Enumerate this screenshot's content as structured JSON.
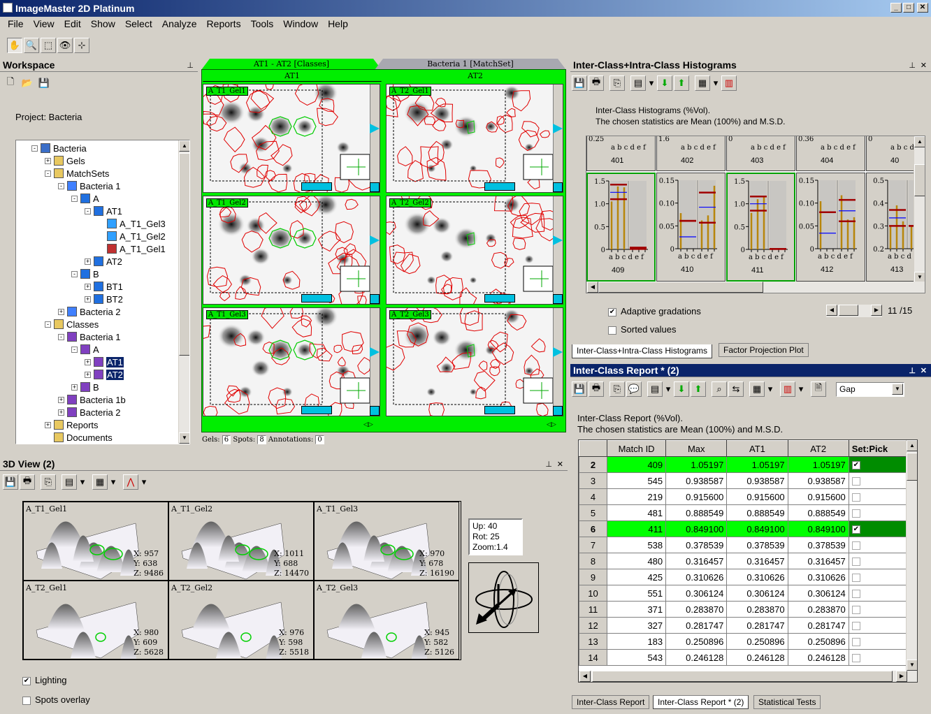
{
  "app": {
    "title": "ImageMaster 2D Platinum"
  },
  "menu": [
    "File",
    "View",
    "Edit",
    "Show",
    "Select",
    "Analyze",
    "Reports",
    "Tools",
    "Window",
    "Help"
  ],
  "toolbar": [
    {
      "icon": "hand-icon",
      "glyph": "✋"
    },
    {
      "icon": "zoom-icon",
      "glyph": "🔍"
    },
    {
      "icon": "rect-select-icon",
      "glyph": "⬚"
    },
    {
      "icon": "eye-icon",
      "glyph": "👁"
    },
    {
      "icon": "measure-icon",
      "glyph": "⊹"
    }
  ],
  "workspace": {
    "title": "Workspace",
    "project_label": "Project: Bacteria",
    "tree": [
      {
        "label": "Bacteria",
        "level": 0,
        "icon": "database",
        "exp": "-"
      },
      {
        "label": "Gels",
        "level": 1,
        "icon": "folder",
        "exp": "+"
      },
      {
        "label": "MatchSets",
        "level": 1,
        "icon": "folder",
        "exp": "-"
      },
      {
        "label": "Bacteria 1",
        "level": 2,
        "icon": "matchset",
        "exp": "-"
      },
      {
        "label": "A",
        "level": 3,
        "icon": "class",
        "exp": "-"
      },
      {
        "label": "AT1",
        "level": 4,
        "icon": "class",
        "exp": "-"
      },
      {
        "label": "A_T1_Gel3",
        "level": 5,
        "icon": "gel",
        "exp": ""
      },
      {
        "label": "A_T1_Gel2",
        "level": 5,
        "icon": "gel",
        "exp": ""
      },
      {
        "label": "A_T1_Gel1",
        "level": 5,
        "icon": "gelref",
        "exp": ""
      },
      {
        "label": "AT2",
        "level": 4,
        "icon": "class",
        "exp": "+"
      },
      {
        "label": "B",
        "level": 3,
        "icon": "class",
        "exp": "-"
      },
      {
        "label": "BT1",
        "level": 4,
        "icon": "class",
        "exp": "+"
      },
      {
        "label": "BT2",
        "level": 4,
        "icon": "class",
        "exp": "+"
      },
      {
        "label": "Bacteria 2",
        "level": 2,
        "icon": "matchset",
        "exp": "+"
      },
      {
        "label": "Classes",
        "level": 1,
        "icon": "folder",
        "exp": "-"
      },
      {
        "label": "Bacteria 1",
        "level": 2,
        "icon": "classes",
        "exp": "-"
      },
      {
        "label": "A",
        "level": 3,
        "icon": "classes",
        "exp": "-"
      },
      {
        "label": "AT1",
        "level": 4,
        "icon": "classes",
        "exp": "+",
        "selected": true
      },
      {
        "label": "AT2",
        "level": 4,
        "icon": "classes",
        "exp": "+",
        "selected": true
      },
      {
        "label": "B",
        "level": 3,
        "icon": "classes",
        "exp": "+"
      },
      {
        "label": "Bacteria 1b",
        "level": 2,
        "icon": "classes",
        "exp": "+"
      },
      {
        "label": "Bacteria 2",
        "level": 2,
        "icon": "classes",
        "exp": "+"
      },
      {
        "label": "Reports",
        "level": 1,
        "icon": "folder",
        "exp": "+"
      },
      {
        "label": "Documents",
        "level": 1,
        "icon": "folder",
        "exp": ""
      }
    ]
  },
  "gelview": {
    "tabs": [
      {
        "label": "AT1 - AT2 [Classes]",
        "active": true
      },
      {
        "label": "Bacteria 1 [MatchSet]",
        "active": false
      }
    ],
    "columns": [
      {
        "label": "AT1",
        "gels": [
          "A_T1_Gel1",
          "A_T1_Gel2",
          "A_T1_Gel3"
        ]
      },
      {
        "label": "AT2",
        "gels": [
          "A_T2_Gel1",
          "A_T2_Gel2",
          "A_T2_Gel3"
        ]
      }
    ],
    "status": {
      "gels_label": "Gels:",
      "gels": "6",
      "spots_label": "Spots:",
      "spots": "8",
      "annotations_label": "Annotations:",
      "annotations": "0"
    },
    "colors": {
      "class_tab": "#00ee00",
      "spot_contour": "#e00000",
      "selected_spot": "#00cc00"
    }
  },
  "view3d": {
    "title": "3D View (2)",
    "cells": [
      {
        "label": "A_T1_Gel1",
        "x": "X: 957",
        "y": "Y: 638",
        "z": "Z: 9486"
      },
      {
        "label": "A_T1_Gel2",
        "x": "X: 1011",
        "y": "Y: 688",
        "z": "Z: 14470"
      },
      {
        "label": "A_T1_Gel3",
        "x": "X: 970",
        "y": "Y: 678",
        "z": "Z: 16190"
      },
      {
        "label": "A_T2_Gel1",
        "x": "X: 980",
        "y": "Y: 609",
        "z": "Z: 5628"
      },
      {
        "label": "A_T2_Gel2",
        "x": "X: 976",
        "y": "Y: 598",
        "z": "Z: 5518"
      },
      {
        "label": "A_T2_Gel3",
        "x": "X: 945",
        "y": "Y: 582",
        "z": "Z: 5126"
      }
    ],
    "info": {
      "up": "Up:  40",
      "rot": "Rot: 25",
      "zoom": "Zoom:1.4"
    },
    "lighting": {
      "label": "Lighting",
      "checked": true
    },
    "spots_overlay": {
      "label": "Spots overlay",
      "checked": false
    }
  },
  "histograms": {
    "title": "Inter-Class+Intra-Class Histograms",
    "desc1": "Inter-Class Histograms (%Vol).",
    "desc2": "The chosen statistics are Mean (100%) and M.S.D.",
    "bar_letters": "a b c d e f",
    "top_row": [
      {
        "id": "401",
        "tick": "0.25"
      },
      {
        "id": "402",
        "tick": "1.6"
      },
      {
        "id": "403",
        "tick": "0"
      },
      {
        "id": "404",
        "tick": "0.36"
      },
      {
        "id": "40",
        "tick": "0"
      }
    ],
    "cells": [
      {
        "id": "409",
        "selected": true,
        "yticks": [
          "0",
          "0.5",
          "1.0",
          "1.5"
        ],
        "ymin": 0,
        "ymax": 1.5,
        "bars": [
          1.05,
          1.38,
          1.36,
          0.03,
          0.03,
          0.03
        ],
        "mean": [
          1.25,
          0.03
        ],
        "msd": [
          [
            1.42,
            1.1
          ],
          [
            0.04,
            0.01
          ]
        ]
      },
      {
        "id": "410",
        "selected": false,
        "yticks": [
          "0",
          "0.05",
          "0.10",
          "0.15"
        ],
        "ymin": 0,
        "ymax": 0.15,
        "bars": [
          0.078,
          0,
          0,
          0.062,
          0.073,
          0.138
        ],
        "mean": [
          0.026,
          0.091
        ],
        "msd": [
          [
            0.061,
            0.061
          ],
          [
            0.123,
            0.057
          ]
        ]
      },
      {
        "id": "411",
        "selected": true,
        "yticks": [
          "0",
          "0.5",
          "1.0",
          "1.5"
        ],
        "ymin": 0,
        "ymax": 1.5,
        "bars": [
          0.8,
          1.1,
          1.15,
          0.01,
          0.01,
          0.01
        ],
        "mean": [
          1.0,
          0.01
        ],
        "msd": [
          [
            1.16,
            0.85
          ],
          [
            0.01,
            0.01
          ]
        ]
      },
      {
        "id": "412",
        "selected": false,
        "yticks": [
          "0",
          "0.05",
          "0.10",
          "0.15"
        ],
        "ymin": 0,
        "ymax": 0.15,
        "bars": [
          0.104,
          0,
          0,
          0.117,
          0.064,
          0.069
        ],
        "mean": [
          0.034,
          0.083
        ],
        "msd": [
          [
            0.08,
            0.08
          ],
          [
            0.107,
            0.06
          ]
        ]
      },
      {
        "id": "413",
        "selected": false,
        "yticks": [
          "0.2",
          "0.3",
          "0.4",
          "0.5"
        ],
        "ymin": 0.2,
        "ymax": 0.5,
        "bars": [
          0.3,
          0.39,
          0.32,
          0.3,
          0.3,
          0.3
        ],
        "mean": [
          0.335,
          0.3
        ],
        "msd": [
          [
            0.37,
            0.3
          ],
          [
            0.3,
            0.3
          ]
        ]
      }
    ],
    "adaptive": {
      "label": "Adaptive gradations",
      "checked": true
    },
    "sorted": {
      "label": "Sorted values",
      "checked": false
    },
    "pager": "11 /15",
    "tabs": [
      "Inter-Class+Intra-Class Histograms",
      "Factor Projection Plot"
    ],
    "colors": {
      "bar": "#b8860b",
      "mean": "#0000ff",
      "msd": "#a00000",
      "selected_border": "#00a000"
    }
  },
  "report": {
    "title": "Inter-Class Report * (2)",
    "combo": "Gap",
    "desc1": "Inter-Class Report (%Vol).",
    "desc2": "The chosen statistics are Mean (100%) and M.S.D.",
    "columns": [
      "",
      "Match ID",
      "Max",
      "AT1",
      "AT2",
      "Set:Pick"
    ],
    "rows": [
      {
        "n": "2",
        "id": "409",
        "max": "1.05197",
        "at1": "1.05197",
        "at2": "1.05197",
        "pick": true
      },
      {
        "n": "3",
        "id": "545",
        "max": "0.938587",
        "at1": "0.938587",
        "at2": "0.938587",
        "pick": false
      },
      {
        "n": "4",
        "id": "219",
        "max": "0.915600",
        "at1": "0.915600",
        "at2": "0.915600",
        "pick": false
      },
      {
        "n": "5",
        "id": "481",
        "max": "0.888549",
        "at1": "0.888549",
        "at2": "0.888549",
        "pick": false
      },
      {
        "n": "6",
        "id": "411",
        "max": "0.849100",
        "at1": "0.849100",
        "at2": "0.849100",
        "pick": true
      },
      {
        "n": "7",
        "id": "538",
        "max": "0.378539",
        "at1": "0.378539",
        "at2": "0.378539",
        "pick": false
      },
      {
        "n": "8",
        "id": "480",
        "max": "0.316457",
        "at1": "0.316457",
        "at2": "0.316457",
        "pick": false
      },
      {
        "n": "9",
        "id": "425",
        "max": "0.310626",
        "at1": "0.310626",
        "at2": "0.310626",
        "pick": false
      },
      {
        "n": "10",
        "id": "551",
        "max": "0.306124",
        "at1": "0.306124",
        "at2": "0.306124",
        "pick": false
      },
      {
        "n": "11",
        "id": "371",
        "max": "0.283870",
        "at1": "0.283870",
        "at2": "0.283870",
        "pick": false
      },
      {
        "n": "12",
        "id": "327",
        "max": "0.281747",
        "at1": "0.281747",
        "at2": "0.281747",
        "pick": false
      },
      {
        "n": "13",
        "id": "183",
        "max": "0.250896",
        "at1": "0.250896",
        "at2": "0.250896",
        "pick": false
      },
      {
        "n": "14",
        "id": "543",
        "max": "0.246128",
        "at1": "0.246128",
        "at2": "0.246128",
        "pick": false
      }
    ],
    "tabs": [
      "Inter-Class Report",
      "Inter-Class Report * (2)",
      "Statistical Tests"
    ],
    "active_tab": 1,
    "colors": {
      "highlight": "#00ff00",
      "pick_highlight": "#008c00"
    }
  }
}
